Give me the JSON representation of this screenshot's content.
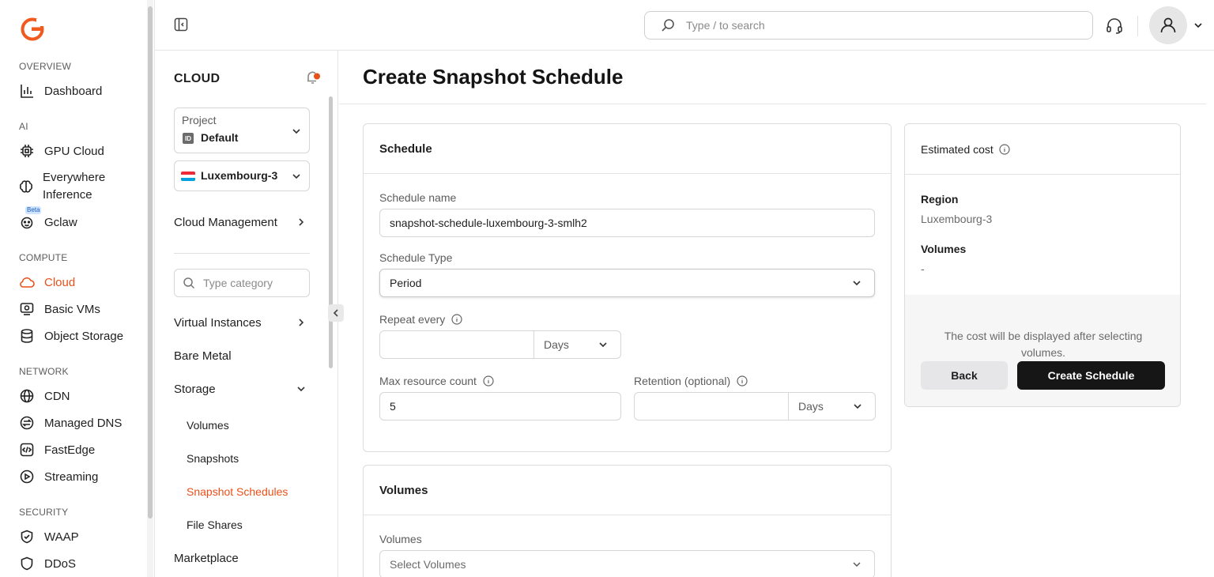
{
  "leftnav": {
    "sections": [
      {
        "title": "OVERVIEW"
      },
      {
        "title": "AI"
      },
      {
        "title": "COMPUTE"
      },
      {
        "title": "NETWORK"
      },
      {
        "title": "SECURITY"
      }
    ],
    "items": [
      {
        "label": "Dashboard",
        "icon": "bar-chart-icon"
      },
      {
        "label": "GPU Cloud",
        "icon": "chip-icon"
      },
      {
        "label": "Everywhere Inference",
        "icon": "brain-icon"
      },
      {
        "label": "Gclaw",
        "icon": "robot-icon",
        "badge": "Beta"
      },
      {
        "label": "Cloud",
        "icon": "cloud-icon",
        "active": true
      },
      {
        "label": "Basic VMs",
        "icon": "server-icon"
      },
      {
        "label": "Object Storage",
        "icon": "database-icon"
      },
      {
        "label": "CDN",
        "icon": "globe-icon"
      },
      {
        "label": "Managed DNS",
        "icon": "dns-icon"
      },
      {
        "label": "FastEdge",
        "icon": "code-icon"
      },
      {
        "label": "Streaming",
        "icon": "play-icon"
      },
      {
        "label": "WAAP",
        "icon": "shield-icon"
      },
      {
        "label": "DDoS",
        "icon": "ddos-icon"
      }
    ]
  },
  "header": {
    "search_placeholder": "Type / to search"
  },
  "subnav": {
    "title": "CLOUD",
    "project": {
      "label": "Project",
      "badge": "ID",
      "value": "Default"
    },
    "region": {
      "value": "Luxembourg-3"
    },
    "cloud_management": "Cloud Management",
    "category_placeholder": "Type category",
    "items": [
      {
        "label": "Virtual Instances"
      },
      {
        "label": "Bare Metal"
      },
      {
        "label": "Storage"
      },
      {
        "label": "Volumes"
      },
      {
        "label": "Snapshots"
      },
      {
        "label": "Snapshot Schedules",
        "active": true
      },
      {
        "label": "File Shares"
      },
      {
        "label": "Marketplace"
      }
    ]
  },
  "main": {
    "title": "Create Snapshot Schedule",
    "schedule_card": {
      "heading": "Schedule",
      "name_label": "Schedule name",
      "name_value": "snapshot-schedule-luxembourg-3-smlh2",
      "type_label": "Schedule Type",
      "type_value": "Period",
      "repeat_label": "Repeat every",
      "repeat_value": "",
      "repeat_unit": "Days",
      "max_label": "Max resource count",
      "max_value": "5",
      "retention_label": "Retention (optional)",
      "retention_value": "",
      "retention_unit": "Days"
    },
    "volumes_card": {
      "heading": "Volumes",
      "label": "Volumes",
      "placeholder": "Select Volumes"
    },
    "cost_card": {
      "heading": "Estimated cost",
      "region_label": "Region",
      "region_value": "Luxembourg-3",
      "volumes_label": "Volumes",
      "volumes_value": "-",
      "note": "The cost will be displayed after selecting volumes.",
      "back_label": "Back",
      "create_label": "Create Schedule"
    }
  },
  "colors": {
    "accent": "#e8501a",
    "primary_button": "#161616"
  }
}
